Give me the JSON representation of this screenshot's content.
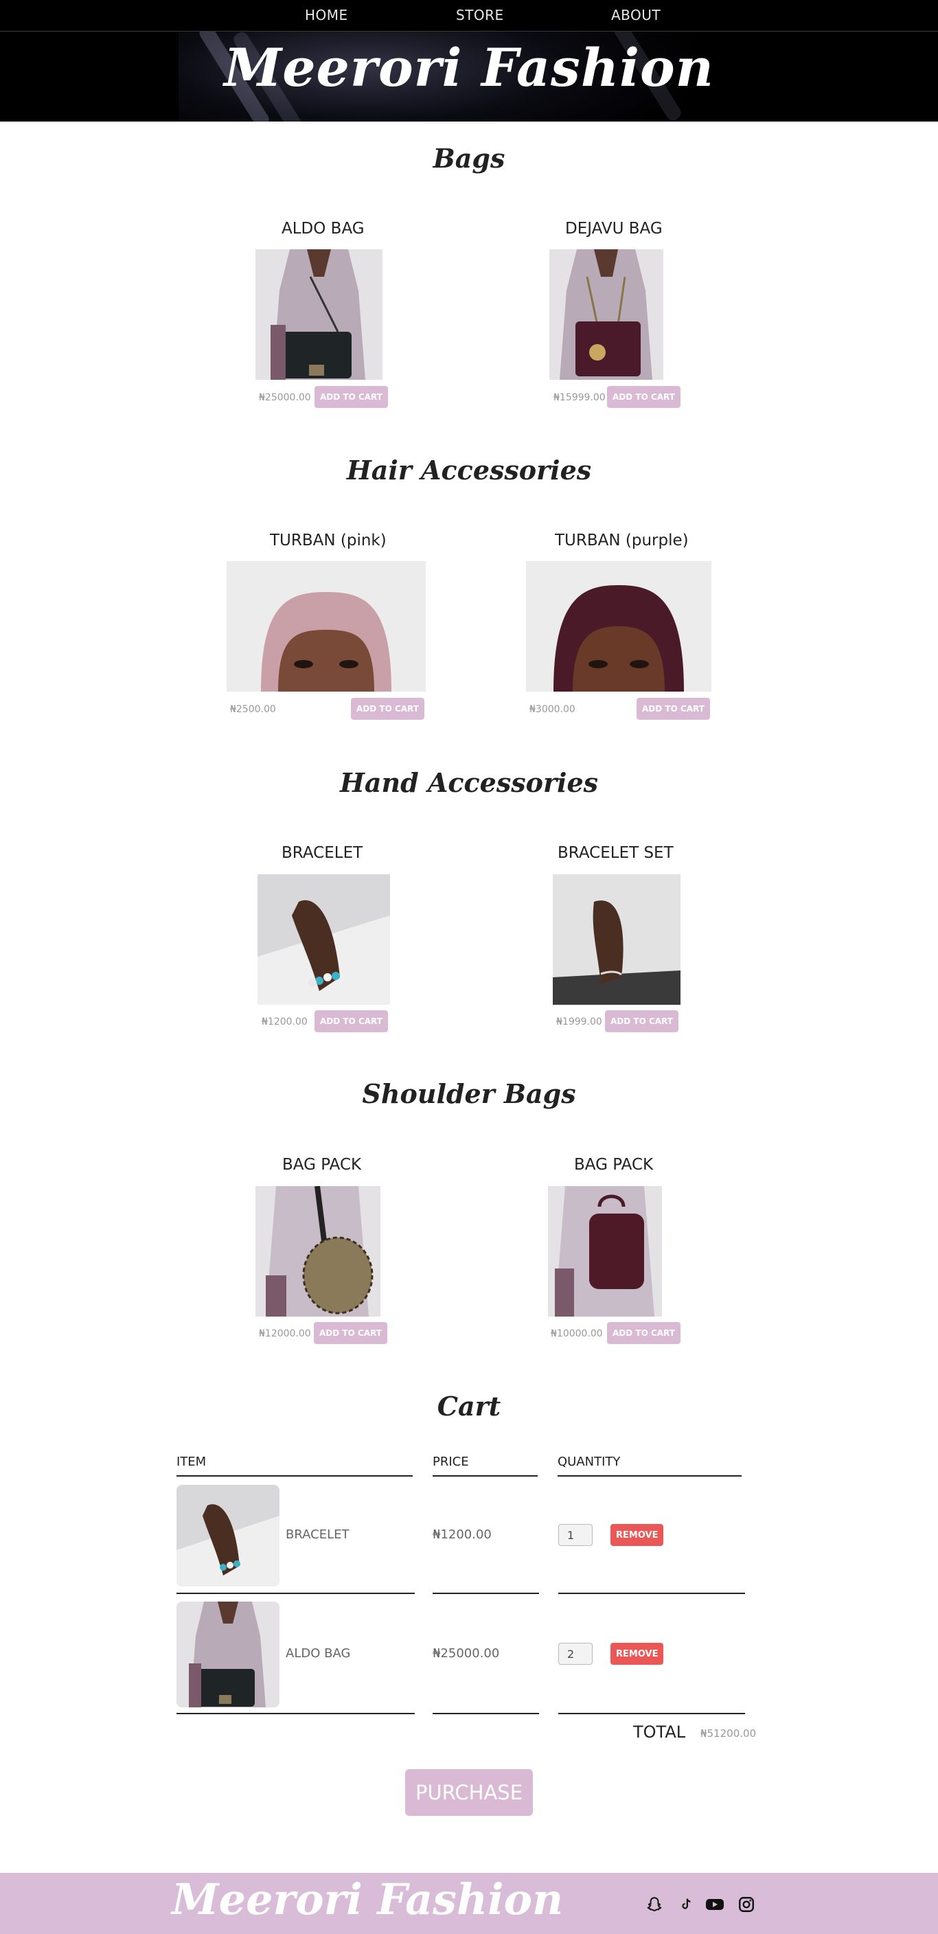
{
  "nav": {
    "home": "HOME",
    "store": "STORE",
    "about": "ABOUT"
  },
  "header": {
    "brand": "Meerori Fashion"
  },
  "sections": [
    {
      "title": "Bags",
      "items": [
        {
          "name": "ALDO BAG",
          "price": "₦25000.00",
          "button": "ADD TO CART"
        },
        {
          "name": "DEJAVU BAG",
          "price": "₦15999.00",
          "button": "ADD TO CART"
        }
      ]
    },
    {
      "title": "Hair Accessories",
      "items": [
        {
          "name": "TURBAN (pink)",
          "price": "₦2500.00",
          "button": "ADD TO CART"
        },
        {
          "name": "TURBAN (purple)",
          "price": "₦3000.00",
          "button": "ADD TO CART"
        }
      ]
    },
    {
      "title": "Hand Accessories",
      "items": [
        {
          "name": "BRACELET",
          "price": "₦1200.00",
          "button": "ADD TO CART"
        },
        {
          "name": "BRACELET SET",
          "price": "₦1999.00",
          "button": "ADD TO CART"
        }
      ]
    },
    {
      "title": "Shoulder Bags",
      "items": [
        {
          "name": "BAG PACK",
          "price": "₦12000.00",
          "button": "ADD TO CART"
        },
        {
          "name": "BAG PACK",
          "price": "₦10000.00",
          "button": "ADD TO CART"
        }
      ]
    }
  ],
  "cart": {
    "title": "Cart",
    "headers": {
      "item": "ITEM",
      "price": "PRICE",
      "quantity": "QUANTITY"
    },
    "rows": [
      {
        "name": "BRACELET",
        "price": "₦1200.00",
        "quantity": "1",
        "remove": "REMOVE"
      },
      {
        "name": "ALDO BAG",
        "price": "₦25000.00",
        "quantity": "2",
        "remove": "REMOVE"
      }
    ],
    "total_label": "TOTAL",
    "total_value": "₦51200.00",
    "purchase": "PURCHASE"
  },
  "footer": {
    "brand": "Meerori Fashion",
    "social_icons": [
      "snapchat-icon",
      "tiktok-icon",
      "youtube-icon",
      "instagram-icon"
    ]
  },
  "colors": {
    "accent": "#d9b9d3",
    "remove": "#eb5757",
    "footer": "#d9bdd8",
    "header": "#000000"
  }
}
